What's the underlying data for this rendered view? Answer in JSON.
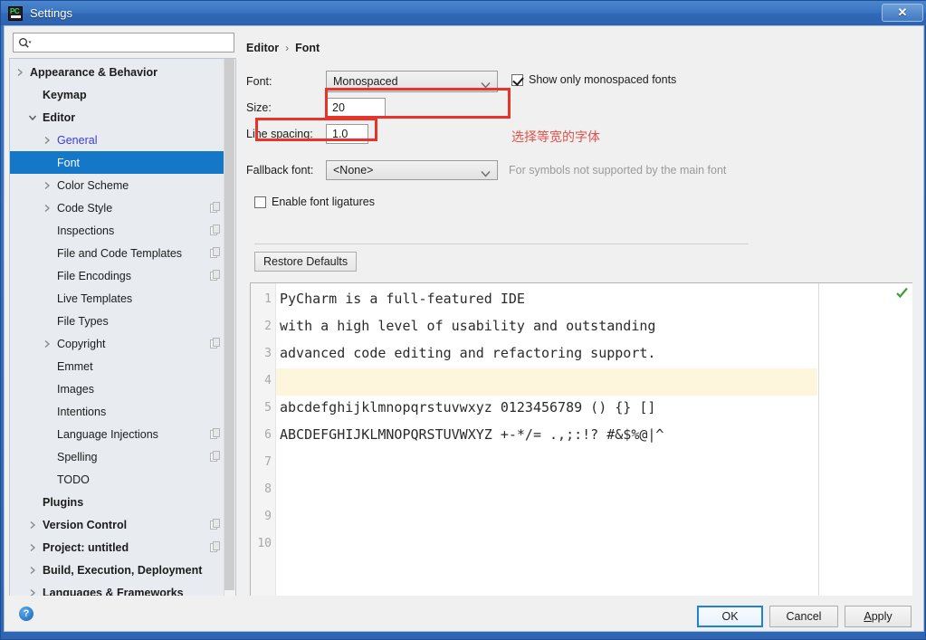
{
  "window": {
    "title": "Settings",
    "app_icon": "pycharm-icon",
    "close_label": "✕"
  },
  "search": {
    "placeholder": "",
    "value": "",
    "icon": "search-icon"
  },
  "sidebar": {
    "items": [
      {
        "label": "Appearance & Behavior",
        "indent": 22,
        "bold": true,
        "arrow": "right",
        "badge": false,
        "selected": false,
        "link": false
      },
      {
        "label": "Keymap",
        "indent": 36,
        "bold": true,
        "arrow": "none",
        "badge": false,
        "selected": false,
        "link": false
      },
      {
        "label": "Editor",
        "indent": 36,
        "bold": true,
        "arrow": "down",
        "badge": false,
        "selected": false,
        "link": false
      },
      {
        "label": "General",
        "indent": 52,
        "bold": false,
        "arrow": "right",
        "badge": false,
        "selected": false,
        "link": true
      },
      {
        "label": "Font",
        "indent": 52,
        "bold": false,
        "arrow": "none",
        "badge": false,
        "selected": true,
        "link": false
      },
      {
        "label": "Color Scheme",
        "indent": 52,
        "bold": false,
        "arrow": "right",
        "badge": false,
        "selected": false,
        "link": false
      },
      {
        "label": "Code Style",
        "indent": 52,
        "bold": false,
        "arrow": "right",
        "badge": true,
        "selected": false,
        "link": false
      },
      {
        "label": "Inspections",
        "indent": 52,
        "bold": false,
        "arrow": "none",
        "badge": true,
        "selected": false,
        "link": false
      },
      {
        "label": "File and Code Templates",
        "indent": 52,
        "bold": false,
        "arrow": "none",
        "badge": true,
        "selected": false,
        "link": false
      },
      {
        "label": "File Encodings",
        "indent": 52,
        "bold": false,
        "arrow": "none",
        "badge": true,
        "selected": false,
        "link": false
      },
      {
        "label": "Live Templates",
        "indent": 52,
        "bold": false,
        "arrow": "none",
        "badge": false,
        "selected": false,
        "link": false
      },
      {
        "label": "File Types",
        "indent": 52,
        "bold": false,
        "arrow": "none",
        "badge": false,
        "selected": false,
        "link": false
      },
      {
        "label": "Copyright",
        "indent": 52,
        "bold": false,
        "arrow": "right",
        "badge": true,
        "selected": false,
        "link": false
      },
      {
        "label": "Emmet",
        "indent": 52,
        "bold": false,
        "arrow": "none",
        "badge": false,
        "selected": false,
        "link": false
      },
      {
        "label": "Images",
        "indent": 52,
        "bold": false,
        "arrow": "none",
        "badge": false,
        "selected": false,
        "link": false
      },
      {
        "label": "Intentions",
        "indent": 52,
        "bold": false,
        "arrow": "none",
        "badge": false,
        "selected": false,
        "link": false
      },
      {
        "label": "Language Injections",
        "indent": 52,
        "bold": false,
        "arrow": "none",
        "badge": true,
        "selected": false,
        "link": false
      },
      {
        "label": "Spelling",
        "indent": 52,
        "bold": false,
        "arrow": "none",
        "badge": true,
        "selected": false,
        "link": false
      },
      {
        "label": "TODO",
        "indent": 52,
        "bold": false,
        "arrow": "none",
        "badge": false,
        "selected": false,
        "link": false
      },
      {
        "label": "Plugins",
        "indent": 36,
        "bold": true,
        "arrow": "none",
        "badge": false,
        "selected": false,
        "link": false
      },
      {
        "label": "Version Control",
        "indent": 36,
        "bold": true,
        "arrow": "right",
        "badge": true,
        "selected": false,
        "link": false
      },
      {
        "label": "Project: untitled",
        "indent": 36,
        "bold": true,
        "arrow": "right",
        "badge": true,
        "selected": false,
        "link": false
      },
      {
        "label": "Build, Execution, Deployment",
        "indent": 36,
        "bold": true,
        "arrow": "right",
        "badge": false,
        "selected": false,
        "link": false
      },
      {
        "label": "Languages & Frameworks",
        "indent": 36,
        "bold": true,
        "arrow": "right",
        "badge": false,
        "selected": false,
        "link": false
      }
    ]
  },
  "content": {
    "breadcrumb": {
      "parent": "Editor",
      "separator": "›",
      "current": "Font"
    },
    "font_row": {
      "label": "Font:",
      "value": "Monospaced"
    },
    "size_row": {
      "label": "Size:",
      "value": "20"
    },
    "line_spacing_row": {
      "label": "Line spacing:",
      "value": "1.0"
    },
    "fallback_row": {
      "label": "Fallback font:",
      "value": "<None>",
      "hint": "For symbols not supported by the main font"
    },
    "show_monospaced": {
      "label": "Show only monospaced fonts",
      "checked": true
    },
    "ligatures": {
      "label": "Enable font ligatures",
      "checked": false
    },
    "restore_defaults": "Restore Defaults",
    "annotation": "选择等宽的字体",
    "annotation_color": "#e0534b",
    "highlight_color": "#e8332a"
  },
  "preview": {
    "line_numbers": [
      "1",
      "2",
      "3",
      "4",
      "5",
      "6",
      "7",
      "8",
      "9",
      "10"
    ],
    "lines": [
      "PyCharm is a full-featured IDE",
      "with a high level of usability and outstanding",
      "advanced code editing and refactoring support.",
      "",
      "abcdefghijklmnopqrstuvwxyz 0123456789 () {} []",
      "ABCDEFGHIJKLMNOPQRSTUVWXYZ +-*/= .,;:!? #&$%@|^",
      "",
      "",
      "",
      ""
    ],
    "caret_line": 4,
    "caret_line_color": "#fdf6dd",
    "status_icon": "check-ok-icon"
  },
  "bottom": {
    "help": "?",
    "ok": "OK",
    "cancel": "Cancel",
    "apply_prefix": "A",
    "apply_rest": "pply"
  }
}
